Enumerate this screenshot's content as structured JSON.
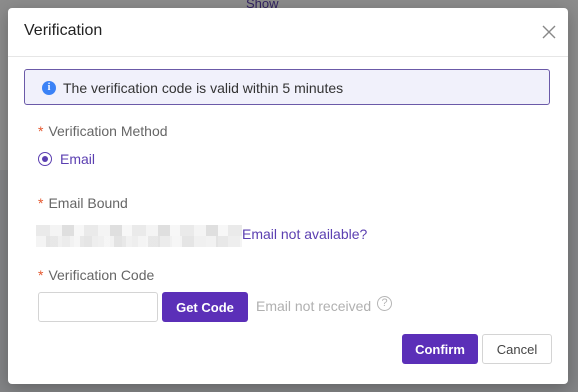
{
  "background": {
    "partial_link_text": "Show"
  },
  "modal": {
    "title": "Verification",
    "close_icon": "close-icon",
    "info": {
      "icon": "info-icon",
      "icon_glyph": "i",
      "text": "The verification code is valid within 5 minutes"
    },
    "required_marker": "*",
    "method": {
      "label": "Verification Method",
      "selected_option": "Email"
    },
    "email_bound": {
      "label": "Email Bound",
      "link_text": "Email not available?"
    },
    "code": {
      "label": "Verification Code",
      "input_value": "",
      "input_placeholder": "",
      "get_code_label": "Get Code",
      "not_received_text": "Email not received",
      "help_glyph": "?"
    },
    "footer": {
      "confirm_label": "Confirm",
      "cancel_label": "Cancel"
    }
  },
  "colors": {
    "accent": "#5b2fb8",
    "info_icon": "#3b82f6",
    "required_star": "#e4572e"
  }
}
